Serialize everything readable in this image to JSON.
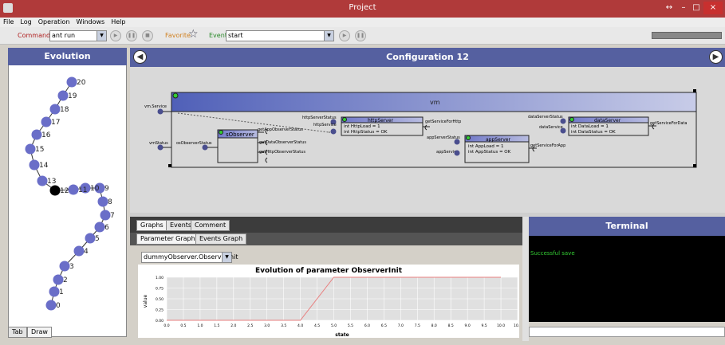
{
  "window": {
    "title": "Project",
    "controls": [
      "↔",
      "–",
      "□",
      "×"
    ]
  },
  "menu": [
    "File",
    "Log",
    "Operation",
    "Windows",
    "Help"
  ],
  "toolbar": {
    "command_label": "Command",
    "command_value": "ant run",
    "favorite_label": "Favorite",
    "event_label": "Event",
    "event_value": "start"
  },
  "evolution": {
    "title": "Evolution",
    "nodes": [
      "0",
      "1",
      "2",
      "3",
      "4",
      "5",
      "6",
      "7",
      "8",
      "9",
      "10",
      "11",
      "12",
      "13",
      "14",
      "15",
      "16",
      "17",
      "18",
      "19",
      "20"
    ],
    "tabs": [
      "Tab",
      "Draw"
    ]
  },
  "config": {
    "title": "Configuration 12",
    "prev": "◀",
    "next": "▶",
    "vm_label": "vm",
    "ports": {
      "vmService": "vm.Service",
      "vmStatus": "vmStatus",
      "osObserverStatus": "osObserverStatus",
      "getAppObserverStatus": "getAppObserverStatus",
      "getDataObserverStatus": "getDataObserverStatus",
      "getHttpObserverStatus": "getHttpObserverStatus",
      "httpServerStatus": "httpServerStatus",
      "httpService": "httpService",
      "getServiceForHttp": "getServiceForHttp",
      "appServerStatus": "appServerStatus",
      "appService": "appService",
      "getServiceForApp": "getServiceForApp",
      "dataServerStatus": "dataServerStatus",
      "dataService": "dataService",
      "getServiceForData": "getServiceForData"
    },
    "components": {
      "observer": {
        "name": "sObserver"
      },
      "httpServer": {
        "name": "httpServer",
        "attrs": [
          "int HttpLoad = 1",
          "int HttpStatus = OK"
        ]
      },
      "appServer": {
        "name": "appServer",
        "attrs": [
          "int AppLoad = 1",
          "int AppStatus = OK"
        ]
      },
      "dataServer": {
        "name": "dataServer",
        "attrs": [
          "int DataLoad = 1",
          "int DataStatus = OK"
        ]
      }
    }
  },
  "bottom": {
    "tabs": [
      "Graphs",
      "Events",
      "Comment"
    ],
    "subtabs": [
      "Parameter Graph",
      "Events Graph"
    ],
    "param_select": "dummyObserver.ObserverInit"
  },
  "chart_data": {
    "type": "line",
    "title": "Evolution of parameter ObserverInit",
    "xlabel": "state",
    "ylabel": "value",
    "xlim": [
      0,
      10.5
    ],
    "ylim": [
      0,
      1.0
    ],
    "xticks": [
      "0.0",
      "0.5",
      "1.0",
      "1.5",
      "2.0",
      "2.5",
      "3.0",
      "3.5",
      "4.0",
      "4.5",
      "5.0",
      "5.5",
      "6.0",
      "6.5",
      "7.0",
      "7.5",
      "8.0",
      "8.5",
      "9.0",
      "9.5",
      "10.0",
      "10.5"
    ],
    "yticks": [
      "0.00",
      "0.25",
      "0.50",
      "0.75",
      "1.00"
    ],
    "series": [
      {
        "color": "#e88080",
        "x": [
          0,
          4,
          5,
          10
        ],
        "y": [
          0,
          0,
          1,
          1
        ]
      }
    ]
  },
  "terminal": {
    "title": "Terminal",
    "text": "Successful save"
  },
  "colors": {
    "header": "#5560a0",
    "node": "#6a6ec8",
    "titlebar": "#b03a3a",
    "vm": "#5560a0"
  }
}
